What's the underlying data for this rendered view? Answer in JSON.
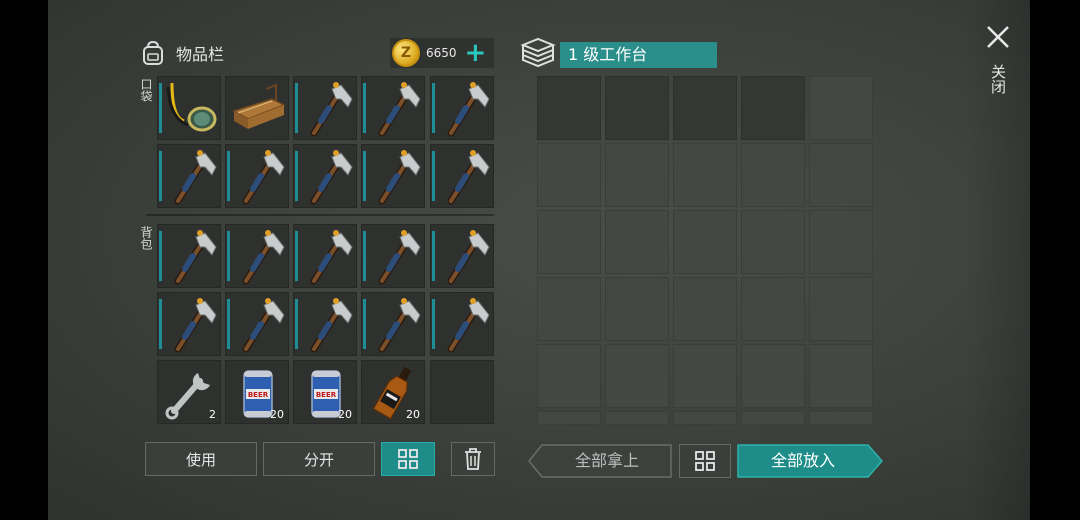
{
  "inventory": {
    "title": "物品栏",
    "currency": "6650",
    "pocket_label": "口袋",
    "backpack_label": "背包",
    "pocket_slots": [
      {
        "item": "goggles-icon",
        "qty": ""
      },
      {
        "item": "workbench-icon",
        "qty": ""
      },
      {
        "item": "hatchet-icon",
        "qty": ""
      },
      {
        "item": "hatchet-icon",
        "qty": ""
      },
      {
        "item": "hatchet-icon",
        "qty": ""
      },
      {
        "item": "hatchet-icon",
        "qty": ""
      },
      {
        "item": "hatchet-icon",
        "qty": ""
      },
      {
        "item": "hatchet-icon",
        "qty": ""
      },
      {
        "item": "hatchet-icon",
        "qty": ""
      },
      {
        "item": "hatchet-icon",
        "qty": ""
      }
    ],
    "backpack_slots": [
      {
        "item": "hatchet-icon",
        "qty": ""
      },
      {
        "item": "hatchet-icon",
        "qty": ""
      },
      {
        "item": "hatchet-icon",
        "qty": ""
      },
      {
        "item": "hatchet-icon",
        "qty": ""
      },
      {
        "item": "hatchet-icon",
        "qty": ""
      },
      {
        "item": "hatchet-icon",
        "qty": ""
      },
      {
        "item": "hatchet-icon",
        "qty": ""
      },
      {
        "item": "hatchet-icon",
        "qty": ""
      },
      {
        "item": "hatchet-icon",
        "qty": ""
      },
      {
        "item": "hatchet-icon",
        "qty": ""
      },
      {
        "item": "wrench-icon",
        "qty": "2"
      },
      {
        "item": "beer-can-icon",
        "qty": "20"
      },
      {
        "item": "beer-can-icon",
        "qty": "20"
      },
      {
        "item": "whiskey-bottle-icon",
        "qty": "20"
      },
      {
        "item": "",
        "qty": ""
      }
    ],
    "buttons": {
      "use": "使用",
      "split": "分开"
    }
  },
  "workbench": {
    "title": "1 级工作台",
    "take_all": "全部拿上",
    "put_all": "全部放入"
  },
  "close_label": "关闭",
  "colors": {
    "accent_teal": "#1e8c88",
    "plus_teal": "#28c8c0",
    "tool_bar": "#1f8e94"
  }
}
